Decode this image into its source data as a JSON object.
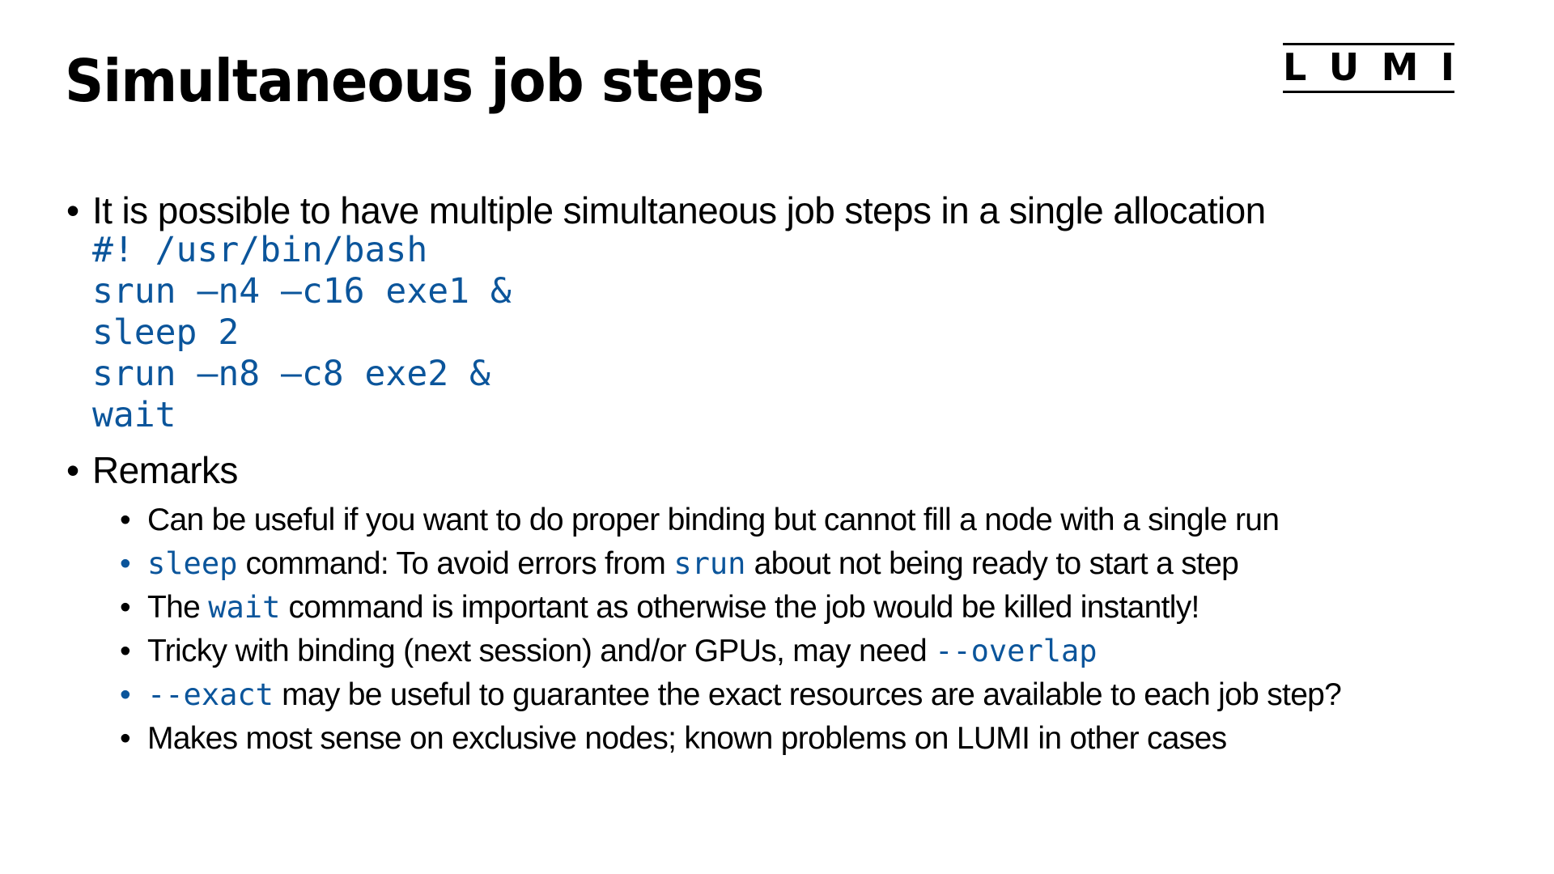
{
  "slide": {
    "title": "Simultaneous job steps",
    "logo": {
      "letters": [
        "L",
        "U",
        "M",
        "I"
      ]
    }
  },
  "colors": {
    "code": "#0b559b",
    "text": "#000000"
  },
  "bullets": [
    {
      "text": "It is possible to have multiple simultaneous job steps in a single allocation",
      "code": [
        "#! /usr/bin/bash",
        "srun –n4 –c16 exe1 &",
        "sleep 2",
        "srun –n8 –c8 exe2 &",
        "wait"
      ]
    },
    {
      "text": "Remarks",
      "sub": [
        {
          "bullet": "•",
          "parts": [
            {
              "t": "Can be useful if you want to do proper binding but cannot fill a node with a single run"
            }
          ]
        },
        {
          "bullet": "•",
          "parts": [
            {
              "c": "sleep"
            },
            {
              "t": " command: To avoid errors from "
            },
            {
              "c": "srun"
            },
            {
              "t": " about not being ready to start a step"
            }
          ]
        },
        {
          "bullet": "•",
          "parts": [
            {
              "t": "The "
            },
            {
              "c": "wait"
            },
            {
              "t": " command is important as otherwise the job would be killed instantly!"
            }
          ]
        },
        {
          "bullet": "•",
          "parts": [
            {
              "t": "Tricky with binding (next session) and/or GPUs, may need "
            },
            {
              "c": "--overlap"
            }
          ]
        },
        {
          "bullet": "•",
          "parts": [
            {
              "c": "--exact"
            },
            {
              "t": " may be useful to guarantee the exact resources are available to each job step?"
            }
          ]
        },
        {
          "bullet": "•",
          "parts": [
            {
              "t": "Makes most sense on exclusive nodes; known problems on LUMI in other cases"
            }
          ]
        }
      ]
    }
  ],
  "bullet_glyph": "•"
}
